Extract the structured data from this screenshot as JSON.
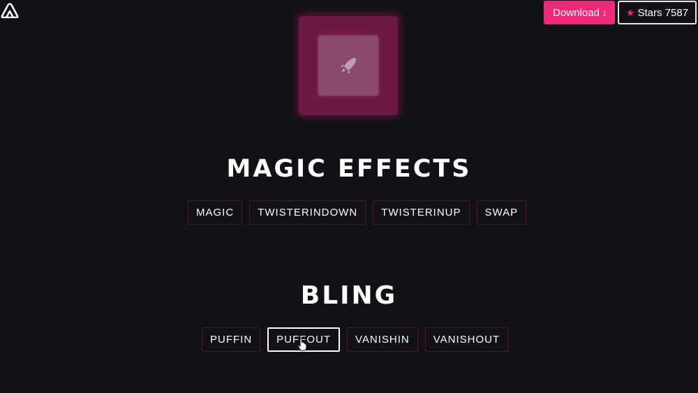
{
  "header": {
    "logo_icon": "nan-logo-icon",
    "download_label": "Download",
    "download_arrow": "↓",
    "stars_icon": "★",
    "stars_label": "Stars 7587"
  },
  "demo": {
    "icon": "rocket-icon",
    "outer_color": "#6e1846",
    "inner_color": "#8a4a6f"
  },
  "sections": {
    "magic": {
      "title": "MAGIC EFFECTS",
      "buttons": [
        "MAGIC",
        "TWISTERINDOWN",
        "TWISTERINUP",
        "SWAP"
      ]
    },
    "bling": {
      "title": "BLING",
      "buttons": [
        "PUFFIN",
        "PUFFOUT",
        "VANISHIN",
        "VANISHOUT"
      ],
      "active": "PUFFOUT"
    }
  },
  "colors": {
    "background": "#131118",
    "accent": "#f0287c"
  }
}
